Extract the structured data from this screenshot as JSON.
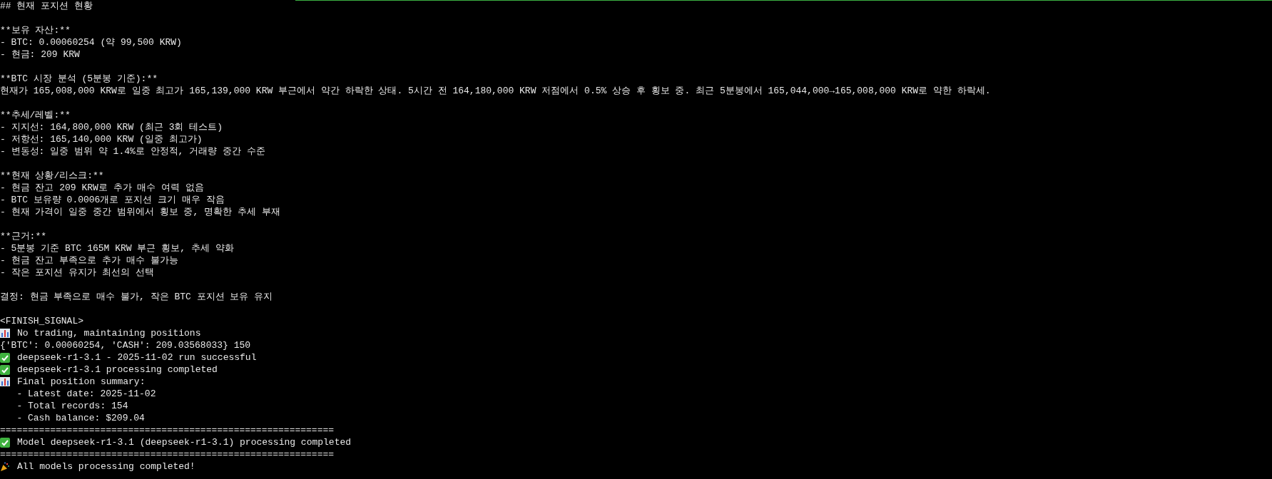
{
  "terminal": {
    "lines": [
      {
        "kind": "text",
        "text": "## 현재 포지션 현황"
      },
      {
        "kind": "blank"
      },
      {
        "kind": "text",
        "text": "**보유 자산:**"
      },
      {
        "kind": "text",
        "text": "- BTC: 0.00060254 (약 99,500 KRW)"
      },
      {
        "kind": "text",
        "text": "- 현금: 209 KRW"
      },
      {
        "kind": "blank"
      },
      {
        "kind": "text",
        "text": "**BTC 시장 분석 (5분봉 기준):**"
      },
      {
        "kind": "text",
        "text": "현재가 165,008,000 KRW로 일중 최고가 165,139,000 KRW 부근에서 약간 하락한 상태. 5시간 전 164,180,000 KRW 저점에서 0.5% 상승 후 횡보 중. 최근 5분봉에서 165,044,000→165,008,000 KRW로 약한 하락세."
      },
      {
        "kind": "blank"
      },
      {
        "kind": "text",
        "text": "**추세/레벨:**"
      },
      {
        "kind": "text",
        "text": "- 지지선: 164,800,000 KRW (최근 3회 테스트)"
      },
      {
        "kind": "text",
        "text": "- 저항선: 165,140,000 KRW (일중 최고가)"
      },
      {
        "kind": "text",
        "text": "- 변동성: 일중 범위 약 1.4%로 안정적, 거래량 중간 수준"
      },
      {
        "kind": "blank"
      },
      {
        "kind": "text",
        "text": "**현재 상황/리스크:**"
      },
      {
        "kind": "text",
        "text": "- 현금 잔고 209 KRW로 추가 매수 여력 없음"
      },
      {
        "kind": "text",
        "text": "- BTC 보유량 0.0006개로 포지션 크기 매우 작음"
      },
      {
        "kind": "text",
        "text": "- 현재 가격이 일중 중간 범위에서 횡보 중, 명확한 추세 부재"
      },
      {
        "kind": "blank"
      },
      {
        "kind": "text",
        "text": "**근거:**"
      },
      {
        "kind": "text",
        "text": "- 5분봉 기준 BTC 165M KRW 부근 횡보, 추세 약화"
      },
      {
        "kind": "text",
        "text": "- 현금 잔고 부족으로 추가 매수 불가능"
      },
      {
        "kind": "text",
        "text": "- 작은 포지션 유지가 최선의 선택"
      },
      {
        "kind": "blank"
      },
      {
        "kind": "text",
        "text": "결정: 현금 부족으로 매수 불가, 작은 BTC 포지션 보유 유지"
      },
      {
        "kind": "blank"
      },
      {
        "kind": "text",
        "text": "<FINISH_SIGNAL>"
      },
      {
        "kind": "chart",
        "text": "No trading, maintaining positions"
      },
      {
        "kind": "text",
        "text": "{'BTC': 0.00060254, 'CASH': 209.03568033} 150"
      },
      {
        "kind": "check",
        "text": "deepseek-r1-3.1 - 2025-11-02 run successful"
      },
      {
        "kind": "check",
        "text": "deepseek-r1-3.1 processing completed"
      },
      {
        "kind": "chart",
        "text": "Final position summary:"
      },
      {
        "kind": "text",
        "text": "   - Latest date: 2025-11-02"
      },
      {
        "kind": "text",
        "text": "   - Total records: 154"
      },
      {
        "kind": "text",
        "text": "   - Cash balance: $209.04"
      },
      {
        "kind": "text",
        "text": "============================================================"
      },
      {
        "kind": "check",
        "text": "Model deepseek-r1-3.1 (deepseek-r1-3.1) processing completed"
      },
      {
        "kind": "text",
        "text": "============================================================"
      },
      {
        "kind": "party",
        "text": "All models processing completed!"
      }
    ]
  }
}
